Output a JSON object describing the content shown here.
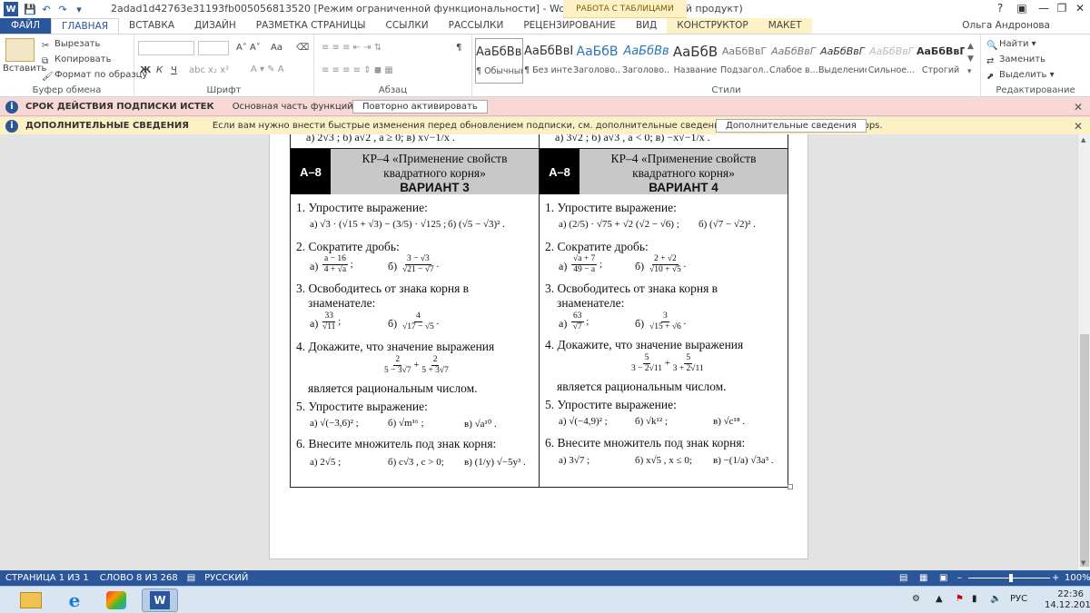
{
  "window": {
    "title": "2adad1d42763e31193fb005056813520 [Режим ограниченной функциональности] - Word (Нелицензированный продукт)",
    "context_group": "РАБОТА С ТАБЛИЦАМИ",
    "user": "Ольга Андронова",
    "help": "?"
  },
  "tabs": [
    {
      "label": "ФАЙЛ"
    },
    {
      "label": "ГЛАВНАЯ"
    },
    {
      "label": "ВСТАВКА"
    },
    {
      "label": "ДИЗАЙН"
    },
    {
      "label": "РАЗМЕТКА СТРАНИЦЫ"
    },
    {
      "label": "ССЫЛКИ"
    },
    {
      "label": "РАССЫЛКИ"
    },
    {
      "label": "РЕЦЕНЗИРОВАНИЕ"
    },
    {
      "label": "ВИД"
    },
    {
      "label": "КОНСТРУКТОР"
    },
    {
      "label": "МАКЕТ"
    }
  ],
  "ribbon": {
    "clipboard": {
      "paste": "Вставить",
      "cut": "Вырезать",
      "copy": "Копировать",
      "format": "Формат по образцу",
      "label": "Буфер обмена"
    },
    "font": {
      "label": "Шрифт",
      "size_dec": "Aa",
      "bold": "Ж",
      "italic": "К",
      "underline": "Ч"
    },
    "paragraph": {
      "label": "Абзац",
      "pilcrow": "¶"
    },
    "styles": {
      "label": "Стили",
      "items": [
        {
          "sample": "АаБбВвГ",
          "name": "¶ Обычный"
        },
        {
          "sample": "АаБбВвГ",
          "name": "¶ Без инте..."
        },
        {
          "sample": "АаБбВ",
          "name": "Заголово..."
        },
        {
          "sample": "АаБбВв",
          "name": "Заголово..."
        },
        {
          "sample": "АаБбВ",
          "name": "Название"
        },
        {
          "sample": "АаБбВвГ",
          "name": "Подзагол..."
        },
        {
          "sample": "АаБбВвГ",
          "name": "Слабое в..."
        },
        {
          "sample": "АаБбВвГ",
          "name": "Выделение"
        },
        {
          "sample": "АаБбВвГ",
          "name": "Сильное..."
        },
        {
          "sample": "АаБбВвГ",
          "name": "Строгий"
        }
      ]
    },
    "editing": {
      "find": "Найти",
      "replace": "Заменить",
      "select": "Выделить",
      "label": "Редактирование"
    }
  },
  "messages": [
    {
      "title": "СРОК ДЕЙСТВИЯ ПОДПИСКИ ИСТЕК",
      "text": "Основная часть функций Word отключена.",
      "button": "Повторно активировать"
    },
    {
      "title": "ДОПОЛНИТЕЛЬНЫЕ СВЕДЕНИЯ",
      "text": "Если вам нужно внести быстрые изменения перед обновлением подписки, см. дополнительные сведения о приложениях Office Web Apps.",
      "button": "Дополнительные сведения"
    }
  ],
  "document": {
    "top_left": "а) 2√3 ;          б) a√2 , a ≥ 0;   в) x√−1/x .",
    "top_right": "а) 3√2 ;          б) a√3 , a < 0;   в) −x√−1/x .",
    "variants": [
      {
        "code": "А–8",
        "title1": "КР–4 «Применение свойств",
        "title2": "квадратного корня»",
        "variant": "ВАРИАНТ 3",
        "q1": "1. Упростите выражение:",
        "q1a": "а) √3 · (√15 + √3) − (3/5) · √125 ;",
        "q1b": "б) (√5 − √3)² .",
        "q2": "2. Сократите дробь:",
        "q2a_label": "а)",
        "q2a_num": "a − 16",
        "q2a_den": "4 + √a",
        "q2b_label": "б)",
        "q2b_num": "3 − √3",
        "q2b_den": "√21 − √7",
        "q3": "3. Освободитесь от знака корня в",
        "q3b": "знаменателе:",
        "q3a_label": "а)",
        "q3a_num": "33",
        "q3a_den": "√11",
        "q3bb_label": "б)",
        "q3bb_num": "4",
        "q3bb_den": "√17 − √5",
        "q4": "4. Докажите, что значение выражения",
        "q4f1_num": "2",
        "q4f1_den": "5 − 3√7",
        "q4f2_num": "2",
        "q4f2_den": "5 + 3√7",
        "q4b": "является рациональным числом.",
        "q5": "5. Упростите выражение:",
        "q5a": "а) √(−3,6)² ;",
        "q5b": "б) √m¹⁶ ;",
        "q5c": "в) √a¹⁰ .",
        "q6": "6. Внесите множитель под знак корня:",
        "q6a": "а) 2√5 ;",
        "q6b": "б) c√3 , c > 0;",
        "q6c": "в) (1/y) √−5y³ ."
      },
      {
        "code": "А–8",
        "title1": "КР–4 «Применение свойств",
        "title2": "квадратного корня»",
        "variant": "ВАРИАНТ 4",
        "q1": "1. Упростите выражение:",
        "q1a": "а) (2/5) · √75 + √2 (√2 − √6) ;",
        "q1b": "б) (√7 − √2)² .",
        "q2": "2. Сократите дробь:",
        "q2a_label": "а)",
        "q2a_num": "√a + 7",
        "q2a_den": "49 − a",
        "q2b_label": "б)",
        "q2b_num": "2 + √2",
        "q2b_den": "√10 + √5",
        "q3": "3. Освободитесь от знака корня в",
        "q3b": "знаменателе:",
        "q3a_label": "а)",
        "q3a_num": "63",
        "q3a_den": "√7",
        "q3bb_label": "б)",
        "q3bb_num": "3",
        "q3bb_den": "√15 + √6",
        "q4": "4. Докажите, что значение выражения",
        "q4f1_num": "5",
        "q4f1_den": "3 − 2√11",
        "q4f2_num": "5",
        "q4f2_den": "3 + 2√11",
        "q4b": "является рациональным числом.",
        "q5": "5. Упростите выражение:",
        "q5a": "а) √(−4,9)² ;",
        "q5b": "б) √k¹² ;",
        "q5c": "в) √c¹⁸ .",
        "q6": "6. Внесите множитель под знак корня:",
        "q6a": "а) 3√7 ;",
        "q6b": "б) x√5 , x ≤ 0;",
        "q6c": "в) −(1/a) √3a³ ."
      }
    ]
  },
  "status": {
    "page": "СТРАНИЦА 1 ИЗ 1",
    "words": "СЛОВО 8 ИЗ 268",
    "lang": "РУССКИЙ",
    "zoom": "100%"
  },
  "tray": {
    "lang": "РУС",
    "time": "22:36",
    "date": "14.12.2013"
  }
}
